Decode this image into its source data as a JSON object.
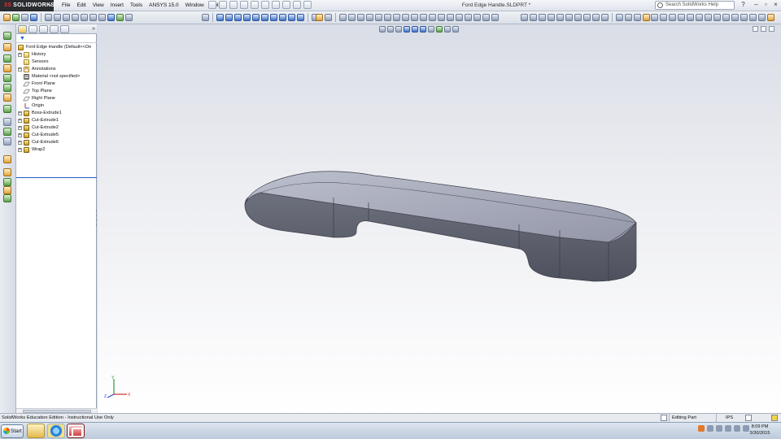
{
  "app": {
    "brand": "SOLIDWORKS",
    "brand_mark": "3S",
    "doc_title": "Ford Edge Handle.SLDPRT *"
  },
  "menu": [
    "File",
    "Edit",
    "View",
    "Insert",
    "Tools",
    "ANSYS 15.0",
    "Window",
    "Help"
  ],
  "search": {
    "placeholder": "Search SolidWorks Help"
  },
  "window_controls": {
    "minimize": "–",
    "restore": "▫",
    "close": "×"
  },
  "feature_manager": {
    "filter_glyph": "▼",
    "more_glyph": "»",
    "root": "Ford Edge Handle  (Default<<De",
    "nodes": [
      {
        "label": "History",
        "icon": "history-folder-icon",
        "expand": "+"
      },
      {
        "label": "Sensors",
        "icon": "sensors-folder-icon",
        "expand": ""
      },
      {
        "label": "Annotations",
        "icon": "annotations-icon",
        "expand": "+"
      },
      {
        "label": "Material <not specified>",
        "icon": "material-icon",
        "expand": ""
      },
      {
        "label": "Front Plane",
        "icon": "plane-icon",
        "expand": ""
      },
      {
        "label": "Top Plane",
        "icon": "plane-icon",
        "expand": ""
      },
      {
        "label": "Right Plane",
        "icon": "plane-icon",
        "expand": ""
      },
      {
        "label": "Origin",
        "icon": "origin-icon",
        "expand": ""
      },
      {
        "label": "Boss-Extrude1",
        "icon": "extrude-icon",
        "expand": "+"
      },
      {
        "label": "Cut-Extrude1",
        "icon": "cut-extrude-icon",
        "expand": "+"
      },
      {
        "label": "Cut-Extrude2",
        "icon": "cut-extrude-icon",
        "expand": "+"
      },
      {
        "label": "Cut-Extrude5",
        "icon": "cut-extrude-icon",
        "expand": "+"
      },
      {
        "label": "Cut-Extrude6",
        "icon": "cut-extrude-icon",
        "expand": "+"
      },
      {
        "label": "Wrap2",
        "icon": "wrap-icon",
        "expand": "+"
      }
    ]
  },
  "status": {
    "edition": "SolidWorks Education Edition - Instructional Use Only",
    "mode": "Editing Part",
    "units": "IPS"
  },
  "taskbar": {
    "start_label": "Start",
    "time": "8:09 PM",
    "date": "3/30/2015"
  },
  "triad": {
    "x": "X",
    "y": "Y",
    "z": "Z"
  },
  "colors": {
    "model_side": "#5d606d",
    "model_top": "#a7aabb",
    "selection_blue": "#2357c9"
  }
}
